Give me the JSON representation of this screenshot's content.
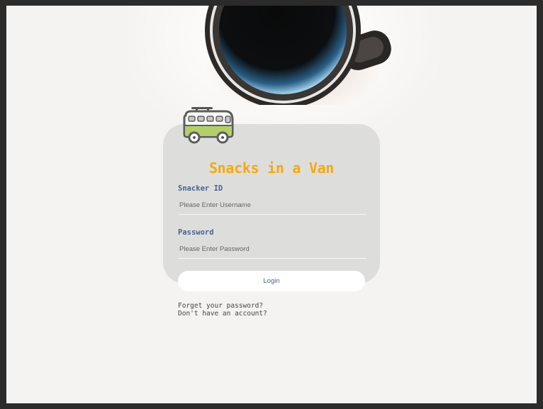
{
  "app": {
    "title": "Snacks in a Van",
    "brand_color": "#f5a90f",
    "label_color": "#4a6393"
  },
  "background": {
    "image": "coffee-mug-photo"
  },
  "logo": {
    "icon": "van-icon"
  },
  "form": {
    "username": {
      "label": "Snacker ID",
      "placeholder": "Please Enter Username",
      "value": ""
    },
    "password": {
      "label": "Password",
      "placeholder": "Please Enter Password",
      "value": ""
    },
    "login_label": "Login"
  },
  "links": {
    "forgot_password": "Forget your password?",
    "no_account": "Don't have an account?"
  }
}
